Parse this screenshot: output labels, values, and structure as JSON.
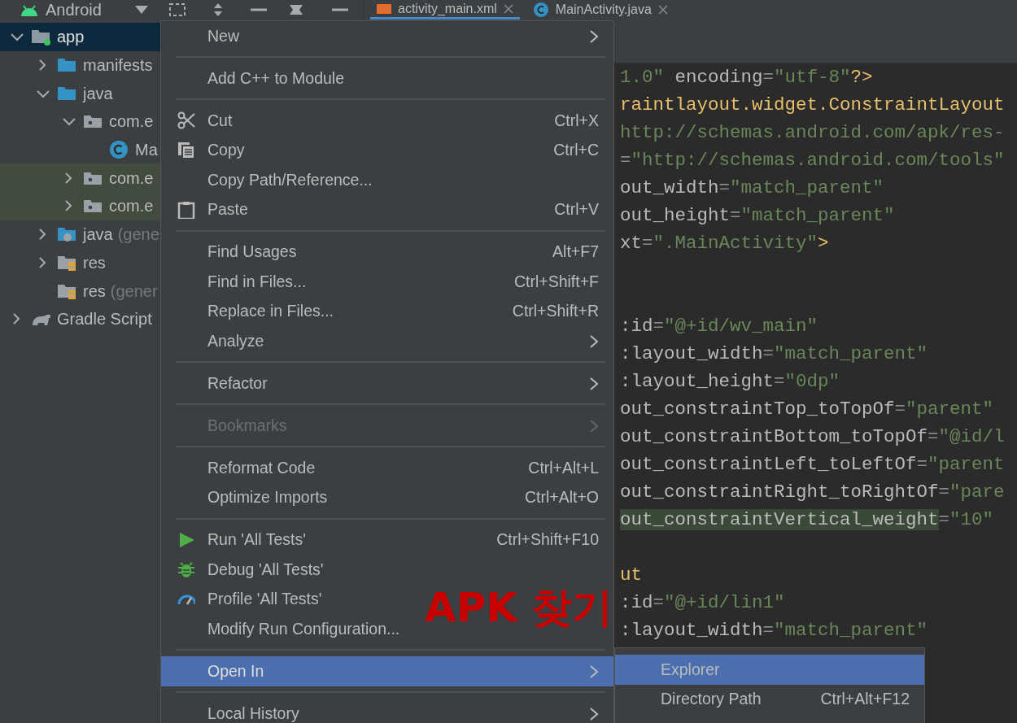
{
  "project_panel": {
    "view": "Android",
    "tree": [
      {
        "label": "app",
        "kind": "module",
        "expanded": true,
        "selected": true,
        "marked": false,
        "children": [
          {
            "label": "manifests",
            "kind": "folder",
            "expanded": false,
            "selected": false,
            "marked": false
          },
          {
            "label": "java",
            "kind": "folder",
            "expanded": true,
            "selected": false,
            "marked": false,
            "children": [
              {
                "label": "com.e",
                "kind": "package",
                "expanded": true,
                "selected": false,
                "marked": false,
                "children": [
                  {
                    "label": "Ma",
                    "kind": "class",
                    "selected": false,
                    "marked": false
                  }
                ]
              },
              {
                "label": "com.e",
                "kind": "package",
                "expanded": false,
                "selected": false,
                "marked": true
              },
              {
                "label": "com.e",
                "kind": "package",
                "expanded": false,
                "selected": false,
                "marked": true
              }
            ]
          },
          {
            "label": "java",
            "suffix": "(gene",
            "kind": "generated",
            "expanded": false,
            "selected": false,
            "marked": false
          },
          {
            "label": "res",
            "kind": "resources",
            "expanded": false,
            "selected": false,
            "marked": false
          },
          {
            "label": "res",
            "suffix": "(gener",
            "kind": "resources",
            "selected": false,
            "marked": false
          }
        ]
      },
      {
        "label": "Gradle Script",
        "kind": "gradle",
        "expanded": false,
        "selected": false,
        "marked": false
      }
    ]
  },
  "editor_tabs": [
    {
      "label": "activity_main.xml",
      "kind": "xml",
      "selected": true
    },
    {
      "label": "MainActivity.java",
      "kind": "class",
      "selected": false
    }
  ],
  "code_lines": [
    {
      "kind": "code",
      "tokens": [
        {
          "kind": "str",
          "text": "1.0\""
        },
        {
          "kind": "attr",
          "text": " encoding"
        },
        {
          "kind": "op",
          "text": "="
        },
        {
          "kind": "str",
          "text": "\"utf-8\""
        },
        {
          "kind": "tag",
          "text": "?>"
        }
      ]
    },
    {
      "kind": "code",
      "tokens": [
        {
          "kind": "tag",
          "text": "raintlayout.widget.ConstraintLayout"
        }
      ]
    },
    {
      "kind": "code",
      "tokens": [
        {
          "kind": "str",
          "text": "http://schemas.android.com/apk/res-"
        }
      ]
    },
    {
      "kind": "code",
      "tokens": [
        {
          "kind": "op",
          "text": "="
        },
        {
          "kind": "str",
          "text": "\"http://schemas.android.com/tools\""
        }
      ]
    },
    {
      "kind": "code",
      "tokens": [
        {
          "kind": "attr",
          "text": "out_width"
        },
        {
          "kind": "op",
          "text": "="
        },
        {
          "kind": "str",
          "text": "\"match_parent\""
        }
      ]
    },
    {
      "kind": "code",
      "tokens": [
        {
          "kind": "attr",
          "text": "out_height"
        },
        {
          "kind": "op",
          "text": "="
        },
        {
          "kind": "str",
          "text": "\"match_parent\""
        }
      ]
    },
    {
      "kind": "code",
      "tokens": [
        {
          "kind": "attr",
          "text": "xt"
        },
        {
          "kind": "op",
          "text": "="
        },
        {
          "kind": "str",
          "text": "\".MainActivity\""
        },
        {
          "kind": "tag",
          "text": ">"
        }
      ]
    },
    {
      "kind": "blank"
    },
    {
      "kind": "blank"
    },
    {
      "kind": "code",
      "tokens": [
        {
          "kind": "attr",
          "text": ":id"
        },
        {
          "kind": "op",
          "text": "="
        },
        {
          "kind": "str",
          "text": "\"@+id/wv_main\""
        }
      ]
    },
    {
      "kind": "code",
      "tokens": [
        {
          "kind": "attr",
          "text": ":layout_width"
        },
        {
          "kind": "op",
          "text": "="
        },
        {
          "kind": "str",
          "text": "\"match_parent\""
        }
      ]
    },
    {
      "kind": "code",
      "tokens": [
        {
          "kind": "attr",
          "text": ":layout_height"
        },
        {
          "kind": "op",
          "text": "="
        },
        {
          "kind": "str",
          "text": "\"0dp\""
        }
      ]
    },
    {
      "kind": "code",
      "tokens": [
        {
          "kind": "attr",
          "text": "out_constraintTop_toTopOf"
        },
        {
          "kind": "op",
          "text": "="
        },
        {
          "kind": "str",
          "text": "\"parent\""
        }
      ]
    },
    {
      "kind": "code",
      "tokens": [
        {
          "kind": "attr",
          "text": "out_constraintBottom_toTopOf"
        },
        {
          "kind": "op",
          "text": "="
        },
        {
          "kind": "str",
          "text": "\"@id/l"
        }
      ]
    },
    {
      "kind": "code",
      "tokens": [
        {
          "kind": "attr",
          "text": "out_constraintLeft_toLeftOf"
        },
        {
          "kind": "op",
          "text": "="
        },
        {
          "kind": "str",
          "text": "\"parent"
        }
      ]
    },
    {
      "kind": "code",
      "tokens": [
        {
          "kind": "attr",
          "text": "out_constraintRight_toRightOf"
        },
        {
          "kind": "op",
          "text": "="
        },
        {
          "kind": "str",
          "text": "\"pare"
        }
      ]
    },
    {
      "kind": "code",
      "tokens": [
        {
          "kind": "match",
          "text": "out_constraintVertical_weight"
        },
        {
          "kind": "op",
          "text": "="
        },
        {
          "kind": "str",
          "text": "\"10\""
        }
      ]
    },
    {
      "kind": "blank"
    },
    {
      "kind": "code",
      "tokens": [
        {
          "kind": "tag",
          "text": "ut"
        }
      ]
    },
    {
      "kind": "code",
      "tokens": [
        {
          "kind": "attr",
          "text": ":id"
        },
        {
          "kind": "op",
          "text": "="
        },
        {
          "kind": "str",
          "text": "\"@+id/lin1\""
        }
      ]
    },
    {
      "kind": "code",
      "tokens": [
        {
          "kind": "attr",
          "text": ":layout_width"
        },
        {
          "kind": "op",
          "text": "="
        },
        {
          "kind": "str",
          "text": "\"match_parent\""
        }
      ]
    }
  ],
  "context_menu": [
    {
      "kind": "item",
      "label": "New",
      "submenu": true,
      "disabled": false,
      "selected": false
    },
    {
      "kind": "separator"
    },
    {
      "kind": "item",
      "label": "Add C++ to Module",
      "disabled": false,
      "selected": false
    },
    {
      "kind": "separator"
    },
    {
      "kind": "cut",
      "label": "Cut",
      "shortcut": "Ctrl+X",
      "disabled": false,
      "selected": false
    },
    {
      "kind": "copy",
      "label": "Copy",
      "shortcut": "Ctrl+C",
      "disabled": false,
      "selected": false
    },
    {
      "kind": "item",
      "label": "Copy Path/Reference...",
      "disabled": false,
      "selected": false
    },
    {
      "kind": "paste",
      "label": "Paste",
      "shortcut": "Ctrl+V",
      "disabled": false,
      "selected": false
    },
    {
      "kind": "separator"
    },
    {
      "kind": "item",
      "label": "Find Usages",
      "shortcut": "Alt+F7",
      "disabled": false,
      "selected": false
    },
    {
      "kind": "item",
      "label": "Find in Files...",
      "shortcut": "Ctrl+Shift+F",
      "disabled": false,
      "selected": false
    },
    {
      "kind": "item",
      "label": "Replace in Files...",
      "shortcut": "Ctrl+Shift+R",
      "disabled": false,
      "selected": false
    },
    {
      "kind": "item",
      "label": "Analyze",
      "submenu": true,
      "disabled": false,
      "selected": false
    },
    {
      "kind": "separator"
    },
    {
      "kind": "item",
      "label": "Refactor",
      "submenu": true,
      "disabled": false,
      "selected": false
    },
    {
      "kind": "separator"
    },
    {
      "kind": "item",
      "label": "Bookmarks",
      "submenu": true,
      "disabled": true,
      "selected": false
    },
    {
      "kind": "separator"
    },
    {
      "kind": "item",
      "label": "Reformat Code",
      "shortcut": "Ctrl+Alt+L",
      "disabled": false,
      "selected": false
    },
    {
      "kind": "item",
      "label": "Optimize Imports",
      "shortcut": "Ctrl+Alt+O",
      "disabled": false,
      "selected": false
    },
    {
      "kind": "separator"
    },
    {
      "kind": "run",
      "label": "Run 'All Tests'",
      "shortcut": "Ctrl+Shift+F10",
      "disabled": false,
      "selected": false
    },
    {
      "kind": "debug",
      "label": "Debug 'All Tests'",
      "disabled": false,
      "selected": false
    },
    {
      "kind": "profile",
      "label": "Profile 'All Tests'",
      "disabled": false,
      "selected": false
    },
    {
      "kind": "item",
      "label": "Modify Run Configuration...",
      "disabled": false,
      "selected": false
    },
    {
      "kind": "separator"
    },
    {
      "kind": "item",
      "label": "Open In",
      "submenu": true,
      "disabled": false,
      "selected": true
    },
    {
      "kind": "separator"
    },
    {
      "kind": "item",
      "label": "Local History",
      "submenu": true,
      "disabled": false,
      "selected": false
    }
  ],
  "submenu": [
    {
      "label": "Explorer",
      "selected": true
    },
    {
      "label": "Directory Path",
      "shortcut": "Ctrl+Alt+F12",
      "selected": false
    }
  ],
  "annotation": "APK 찾기"
}
